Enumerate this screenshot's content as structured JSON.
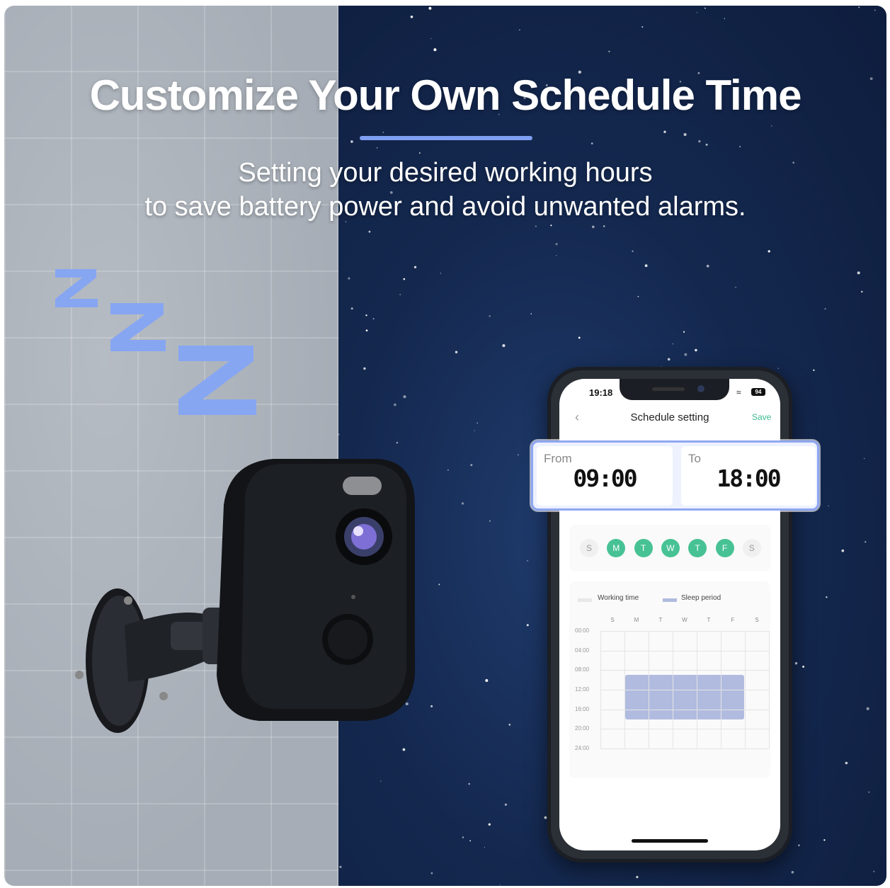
{
  "headline": "Customize Your Own Schedule Time",
  "subtitle_line1": "Setting your desired working hours",
  "subtitle_line2": "to save battery power and avoid unwanted alarms.",
  "phone": {
    "status_time": "19:18",
    "battery": "94",
    "title": "Schedule setting",
    "save_label": "Save",
    "back_icon": "chevron-left-icon",
    "days": [
      {
        "label": "S",
        "active": false
      },
      {
        "label": "M",
        "active": true
      },
      {
        "label": "T",
        "active": true
      },
      {
        "label": "W",
        "active": true
      },
      {
        "label": "T",
        "active": true
      },
      {
        "label": "F",
        "active": true
      },
      {
        "label": "S",
        "active": false
      }
    ],
    "legend_working": "Working time",
    "legend_sleep": "Sleep period",
    "chart_columns": [
      "S",
      "M",
      "T",
      "W",
      "T",
      "F",
      "S"
    ],
    "chart_rows": [
      "00:00",
      "04:00",
      "08:00",
      "12:00",
      "16:00",
      "20:00",
      "24:00"
    ],
    "sleep_block": {
      "from_day": 1,
      "to_day": 5,
      "from_hour": 9,
      "to_hour": 18
    }
  },
  "popup": {
    "from_label": "From",
    "from_time": "09:00",
    "to_label": "To",
    "to_time": "18:00"
  },
  "colors": {
    "accent": "#7f9ff2",
    "day_active": "#47c294",
    "sleep": "#b0bbdf",
    "night": "#14284f",
    "wall": "#a6adb6"
  }
}
